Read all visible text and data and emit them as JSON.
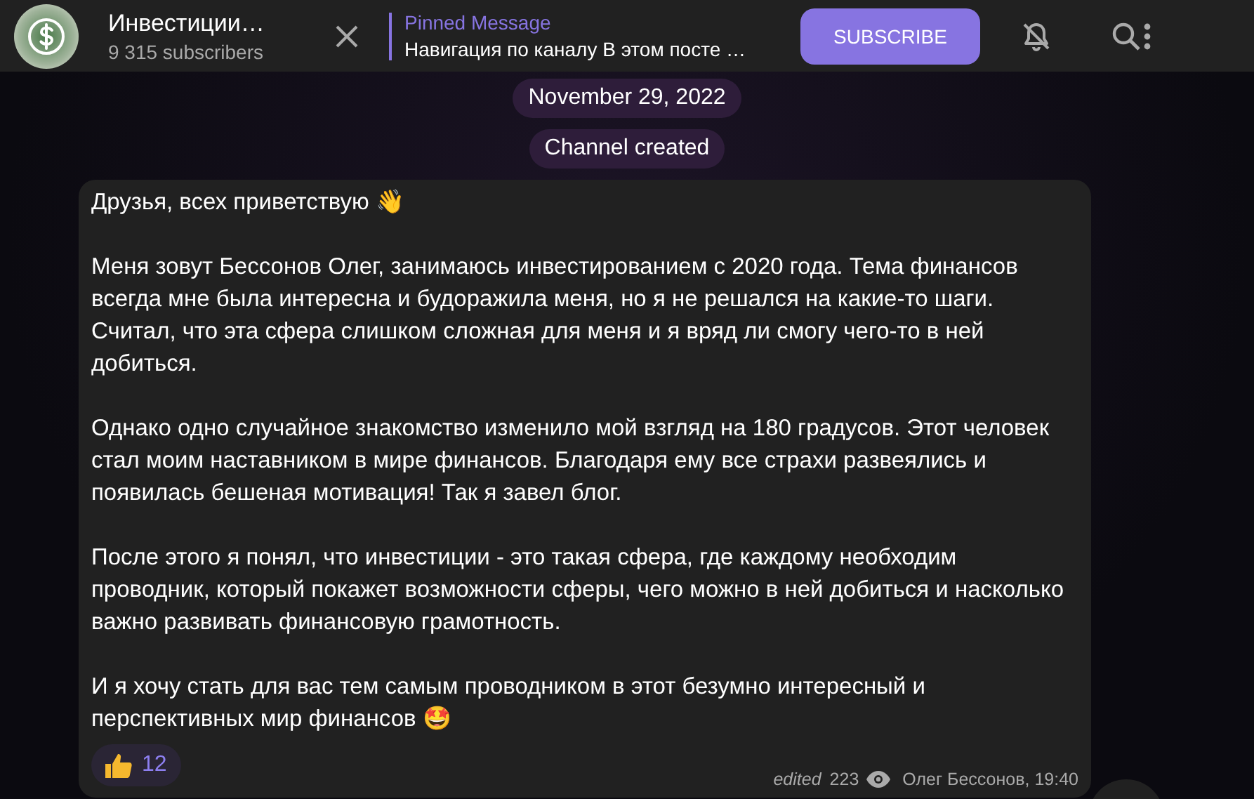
{
  "channel": {
    "title": "Инвестиции…",
    "subscribers": "9 315 subscribers"
  },
  "pinned": {
    "label": "Pinned Message",
    "text": "Навигация по каналу В этом посте …"
  },
  "subscribe_button": "SUBSCRIBE",
  "service_messages": [
    "November 29, 2022",
    "Channel created"
  ],
  "message": {
    "paragraphs": [
      "Друзья, всех приветствую 👋",
      "Меня зовут Бессонов Олег, занимаюсь инвестированием с 2020 года. Тема финансов всегда мне была интересна и будоражила меня, но я не решался на какие-то шаги. Считал, что эта сфера слишком сложная для меня и я вряд ли смогу чего-то в ней добиться.",
      "Однако одно случайное знакомство изменило мой взгляд на 180 градусов. Этот человек стал моим наставником в мире финансов. Благодаря ему все страхи развеялись и появилась бешеная мотивация! Так я завел блог.",
      "После этого я понял, что инвестиции - это такая сфера, где каждому необходим проводник, который покажет возможности сферы, чего можно в ней добиться и насколько важно развивать финансовую грамотность.",
      "И я хочу стать для вас тем самым проводником в этот безумно интересный и перспективных мир финансов 🤩"
    ],
    "reactions": [
      {
        "count": "12"
      }
    ],
    "edited": "edited",
    "views": "223",
    "signature": "Олег Бессонов, 19:40"
  }
}
